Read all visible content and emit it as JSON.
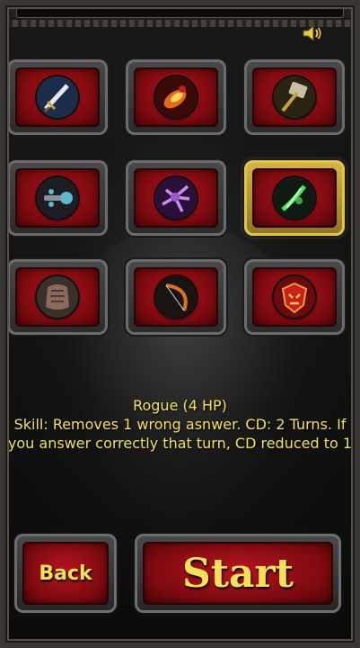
{
  "topbar": {
    "sound_icon": "speaker-icon"
  },
  "classes": [
    {
      "icon": "sword-icon",
      "selected": false
    },
    {
      "icon": "flaming-fist-icon",
      "selected": false
    },
    {
      "icon": "hammer-icon",
      "selected": false
    },
    {
      "icon": "spiked-mace-icon",
      "selected": false
    },
    {
      "icon": "purple-claw-icon",
      "selected": false
    },
    {
      "icon": "green-dagger-icon",
      "selected": true
    },
    {
      "icon": "armor-icon",
      "selected": false
    },
    {
      "icon": "bow-icon",
      "selected": false
    },
    {
      "icon": "horde-emblem-icon",
      "selected": false
    }
  ],
  "selection": {
    "name": "Rogue (4 HP)",
    "skill": "Skill: Removes 1 wrong asnwer. CD: 2 Turns. If you answer correctly that turn, CD reduced to 1"
  },
  "buttons": {
    "back": "Back",
    "start": "Start"
  },
  "colors": {
    "text": "#f4e05a",
    "tile_red": "#b0121b",
    "selected_border": "#e3c44a"
  }
}
